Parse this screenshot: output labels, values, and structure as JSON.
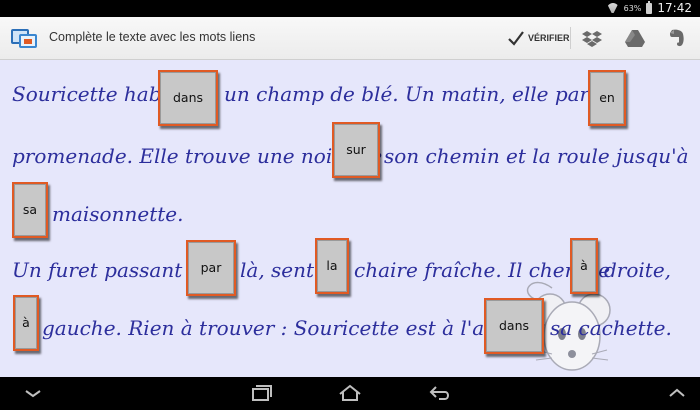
{
  "status_bar": {
    "battery_percent": "63%",
    "time": "17:42"
  },
  "action_bar": {
    "title": "Complète le texte avec les mots liens",
    "verify_label": "VÉRIFIER",
    "icons": [
      "app-icon",
      "checkmark-icon",
      "dropbox-icon",
      "google-drive-icon",
      "evernote-icon"
    ]
  },
  "exercise": {
    "lines": [
      {
        "segments": [
          "Souricette habite",
          "un champ de blé. Un matin, elle part"
        ]
      },
      {
        "segments": [
          "promenade. Elle trouve une noisette",
          "son chemin et la roule jusqu'à"
        ]
      },
      {
        "segments": [
          "maisonnette."
        ]
      },
      {
        "segments": [
          "Un furet passant",
          "là, sent",
          "chaire fraîche. Il cherche",
          "droite,"
        ]
      },
      {
        "segments": [
          "gauche. Rien à trouver :  Souricette est à l'abri",
          "sa cachette."
        ]
      }
    ],
    "tiles": [
      "dans",
      "en",
      "sur",
      "sa",
      "par",
      "la",
      "à",
      "à",
      "dans"
    ]
  },
  "nav_bar": {
    "icons": [
      "keyboard-hide-icon",
      "recent-apps-icon",
      "home-icon",
      "back-icon",
      "menu-icon"
    ]
  },
  "colors": {
    "text": "#2c2e9c",
    "background": "#e6e7fb",
    "tile_border": "#e05a24",
    "tile_fill": "#c8c8c8"
  }
}
